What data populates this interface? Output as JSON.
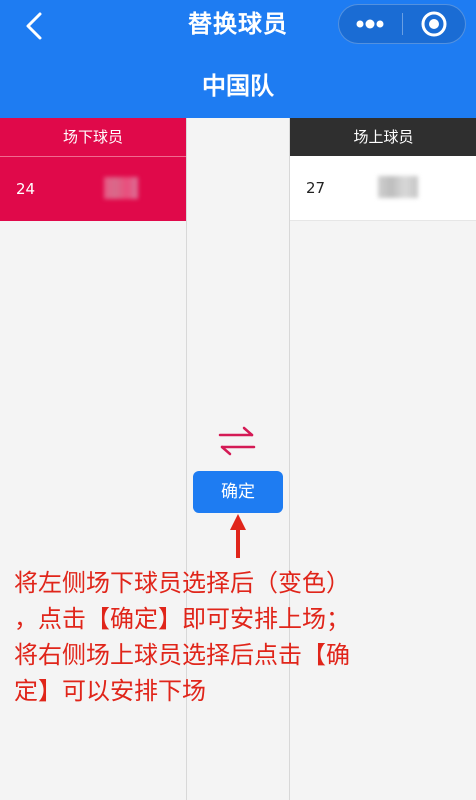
{
  "nav": {
    "title": "替换球员",
    "team_name": "中国队",
    "back_icon": "chevron-left-icon",
    "more_icon": "more-dots-icon",
    "close_icon": "target-circle-icon"
  },
  "bench": {
    "header": "场下球员",
    "players": [
      {
        "number": "24",
        "selected": true
      }
    ]
  },
  "court": {
    "header": "场上球员",
    "players": [
      {
        "number": "27",
        "selected": false
      }
    ]
  },
  "actions": {
    "swap_icon": "swap-arrows-icon",
    "confirm_label": "确定"
  },
  "annotation": {
    "text": "将左侧场下球员选择后（变色）\n，点击【确定】即可安排上场；\n将右侧场上球员选择后点击【确\n定】可以安排下场"
  },
  "colors": {
    "primary": "#1e7cf2",
    "selected": "#e0094a",
    "dark_header": "#2f2f2f",
    "annotation": "#e0251a"
  }
}
